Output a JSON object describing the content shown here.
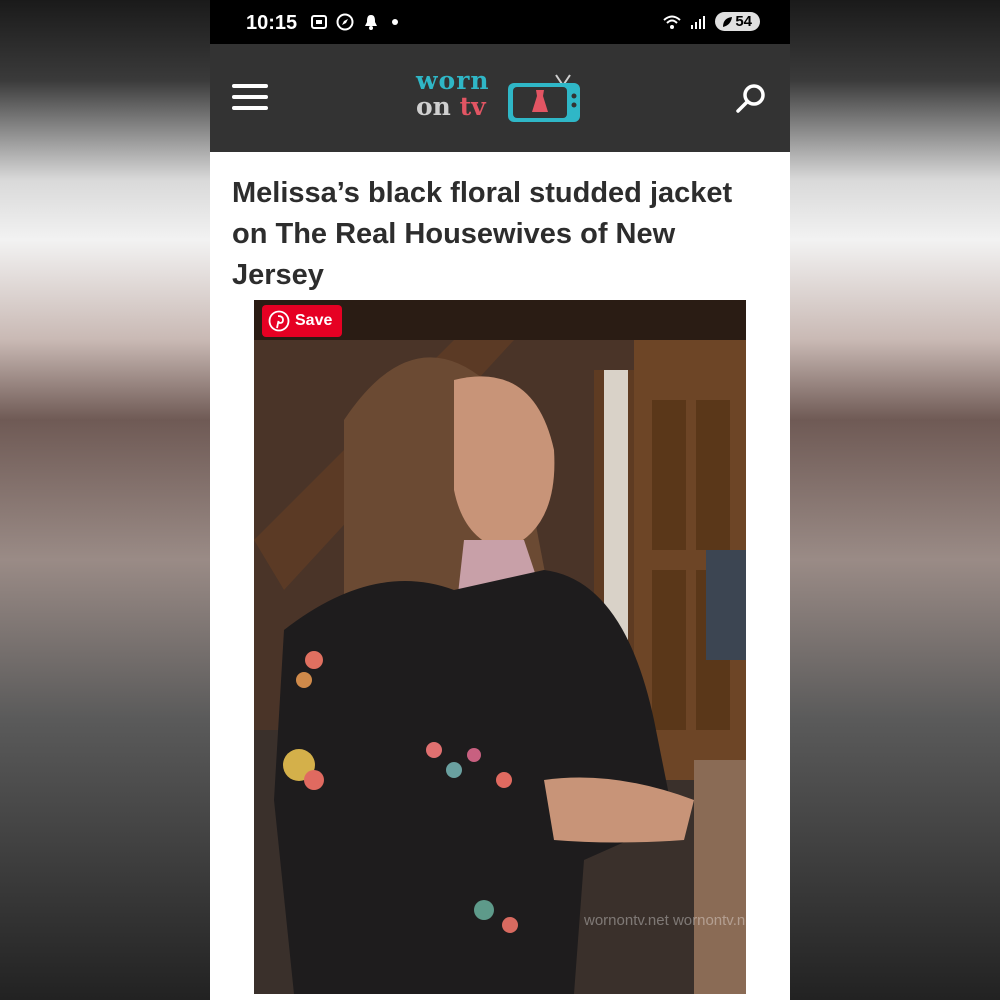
{
  "status_bar": {
    "time": "10:15",
    "battery": "54"
  },
  "header": {
    "logo_line1": "worn",
    "logo_line2_a": "on",
    "logo_line2_b": "tv",
    "menu_icon": "hamburger-menu-icon",
    "search_icon": "search-icon"
  },
  "article": {
    "title": "Melissa’s black floral studded jacket on The Real Housewives of New Jersey"
  },
  "image": {
    "save_label": "Save",
    "watermark": "wornontv.net wornontv.net wornontv.net"
  },
  "colors": {
    "nav_bg": "#333333",
    "brand_teal": "#2fb7c7",
    "brand_pink": "#e25563",
    "pinterest_red": "#e60023"
  }
}
